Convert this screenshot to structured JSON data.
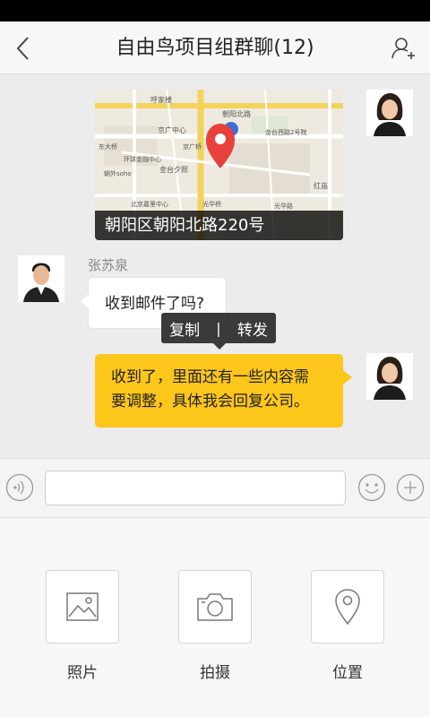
{
  "header": {
    "title": "自由鸟项目组群聊(12)",
    "back_icon": "chevron-left-icon",
    "add_member_icon": "add-person-icon"
  },
  "messages": {
    "location_card": {
      "address": "朝阳区朝阳北路220号",
      "map_labels": [
        "呼家楼",
        "朝阳北路",
        "东大桥",
        "京广中心",
        "朝外soho",
        "环球金融中心",
        "金台西路2号院",
        "金台夕照",
        "红庙",
        "北京嘉里中心",
        "光华桥",
        "光华路",
        "京广桥"
      ]
    },
    "incoming": {
      "sender": "张苏泉",
      "text": "收到邮件了吗?"
    },
    "context_menu": {
      "copy": "复制",
      "separator": "|",
      "forward": "转发"
    },
    "outgoing": {
      "line1": "收到了，里面还有一些内容需",
      "line2": "要调整，具体我会回复公司。"
    }
  },
  "input_bar": {
    "value": "",
    "voice_icon": "voice-icon",
    "emoji_icon": "emoji-icon",
    "plus_icon": "plus-icon"
  },
  "actions": [
    {
      "label": "照片",
      "icon": "image-icon"
    },
    {
      "label": "拍摄",
      "icon": "camera-icon"
    },
    {
      "label": "位置",
      "icon": "location-pin-icon"
    }
  ],
  "colors": {
    "accent_yellow": "#fcc61b",
    "map_pin": "#e8403a",
    "menu_bg": "#3a3a3a"
  }
}
